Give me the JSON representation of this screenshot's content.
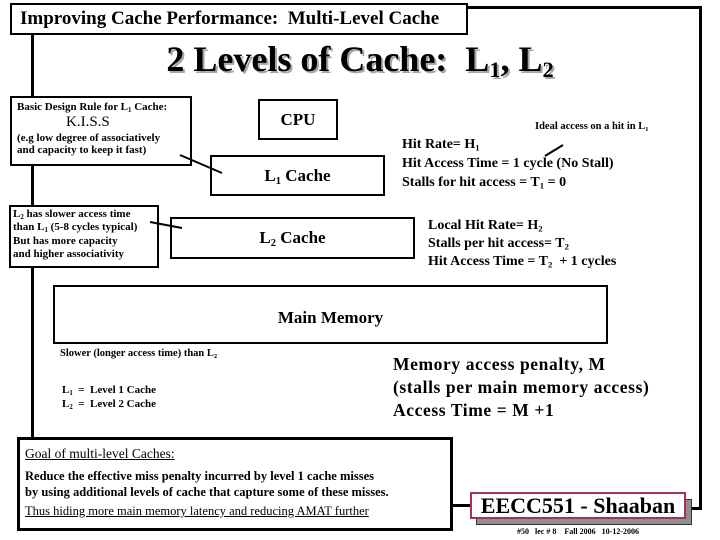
{
  "title_box": {
    "text": "Improving Cache Performance:  Multi-Level Cache"
  },
  "heading": {
    "prefix": "2 Levels of Cache:  L",
    "sub1": "1",
    "mid": ", L",
    "sub2": "2"
  },
  "kiss_note": {
    "line1": {
      "prefix": "Basic Design Rule for L",
      "sub": "1",
      "suffix": " Cache:"
    },
    "acronym": "K.I.S.S",
    "line3": "(e.g low degree of associatively",
    "line4": "and capacity to keep it fast)"
  },
  "diagram": {
    "cpu": "CPU",
    "l1_cache": {
      "prefix": "L",
      "sub": "1",
      "suffix": " Cache"
    },
    "l2_cache": {
      "prefix": "L",
      "sub": "2",
      "suffix": " Cache"
    },
    "main_memory": "Main Memory"
  },
  "l1_stats": {
    "ideal_note": {
      "prefix": "Ideal access on a hit in L",
      "sub": "1"
    },
    "hit_rate": {
      "prefix": "Hit Rate= H",
      "sub": "1"
    },
    "hit_access_time": "Hit Access Time = 1 cycle (No Stall)",
    "stalls": {
      "prefix": "Stalls for hit access = T",
      "sub": "1",
      "suffix": " = 0"
    }
  },
  "l2_note": {
    "line1": {
      "prefix": "L",
      "sub": "2",
      "suffix": " has slower access time"
    },
    "line2": {
      "prefix": "than L",
      "sub": "1",
      "suffix": " (5-8 cycles typical)"
    },
    "line3": "But has more capacity",
    "line4": "and higher associativity"
  },
  "l2_stats": {
    "local_hit_rate": {
      "prefix": "Local Hit Rate= H",
      "sub": "2"
    },
    "stalls": {
      "prefix": "Stalls per hit access= T",
      "sub": "2"
    },
    "hit_access_time": {
      "prefix": "Hit Access Time = T",
      "sub": "2",
      "suffix": "  + 1 cycles"
    }
  },
  "memory_note": {
    "prefix": "Slower (longer access time) than L",
    "sub": "2"
  },
  "legend": [
    {
      "prefix": "L",
      "sub": "1",
      "suffix": "  =  Level 1 Cache"
    },
    {
      "prefix": "L",
      "sub": "2",
      "suffix": "  =  Level 2 Cache"
    }
  ],
  "memory_stats": [
    "Memory access penalty, M",
    "(stalls per main memory access)",
    "Access Time = M +1"
  ],
  "goal": {
    "heading": "Goal of multi-level Caches:",
    "lines": [
      "Reduce the effective miss penalty incurred by level 1 cache misses",
      "by using additional levels of cache that capture some of these misses."
    ],
    "conclusion": "Thus hiding more main memory latency and reducing AMAT further"
  },
  "footer": {
    "course": "EECC551 - Shaaban",
    "info": "#50   lec # 8    Fall 2006   10-12-2006"
  },
  "colors": {
    "text": "#000000",
    "background": "#ffffff",
    "course_box_border": "#a3344c",
    "course_box_shadow": "#8f8f8f",
    "heading_shadow": "#a6a6a6"
  }
}
